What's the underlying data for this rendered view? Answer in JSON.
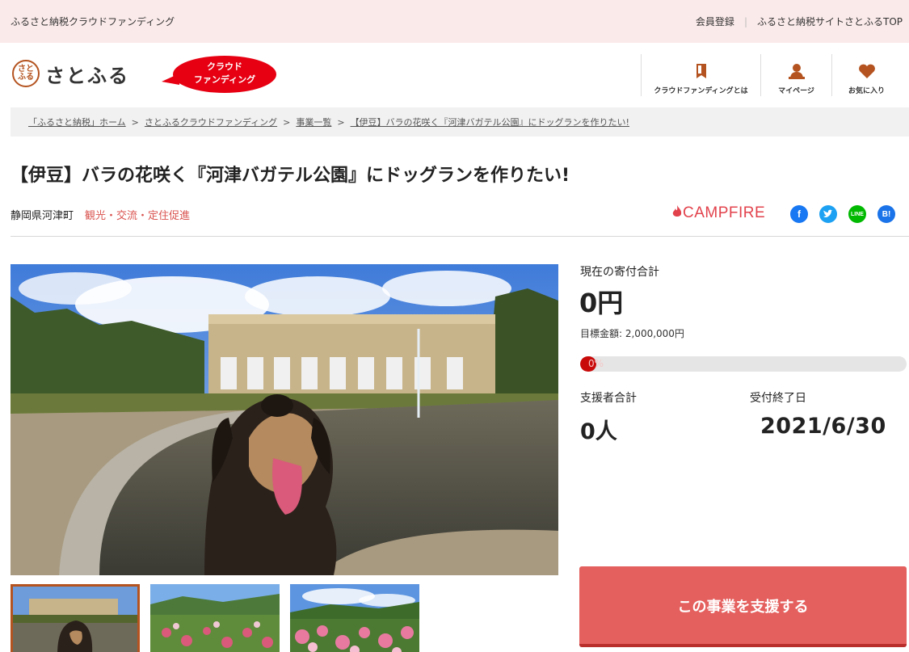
{
  "topbar": {
    "site_name": "ふるさと納税クラウドファンディング",
    "links": [
      "会員登録",
      "ふるさと納税サイトさとふるTOP"
    ]
  },
  "header": {
    "logo_mark": "さと ふる",
    "logo_text": "さとふる",
    "badge_line1": "クラウド",
    "badge_line2": "ファンディング",
    "nav": [
      {
        "label": "クラウドファンディングとは",
        "icon": "book-icon"
      },
      {
        "label": "マイページ",
        "icon": "user-icon"
      },
      {
        "label": "お気に入り",
        "icon": "heart-icon"
      }
    ],
    "icon_color": "#b4531f"
  },
  "breadcrumb": [
    "「ふるさと納税」ホーム",
    "さとふるクラウドファンディング",
    "事業一覧",
    "【伊豆】バラの花咲く『河津バガテル公園』にドッグランを作りたい!"
  ],
  "project": {
    "title": "【伊豆】バラの花咲く『河津バガテル公園』にドッグランを作りたい!",
    "town": "静岡県河津町",
    "category": "観光・交流・定住促進",
    "partner": "CAMPFIRE",
    "share": {
      "facebook": "f",
      "twitter": "t",
      "line": "LINE",
      "hatena": "B!"
    }
  },
  "stats": {
    "total_label": "現在の寄付合計",
    "total_value": "0円",
    "goal": "目標金額: 2,000,000円",
    "progress_percent": 0,
    "progress_label": "0%",
    "supporters_label": "支援者合計",
    "supporters_value": "0人",
    "deadline_label": "受付終了日",
    "deadline_value": "2021/6/30"
  },
  "cta": {
    "label": "この事業を支援する"
  },
  "colors": {
    "accent": "#e4605e",
    "brand": "#b4531f",
    "topbar": "#fbeaea",
    "category": "#d9534f"
  }
}
